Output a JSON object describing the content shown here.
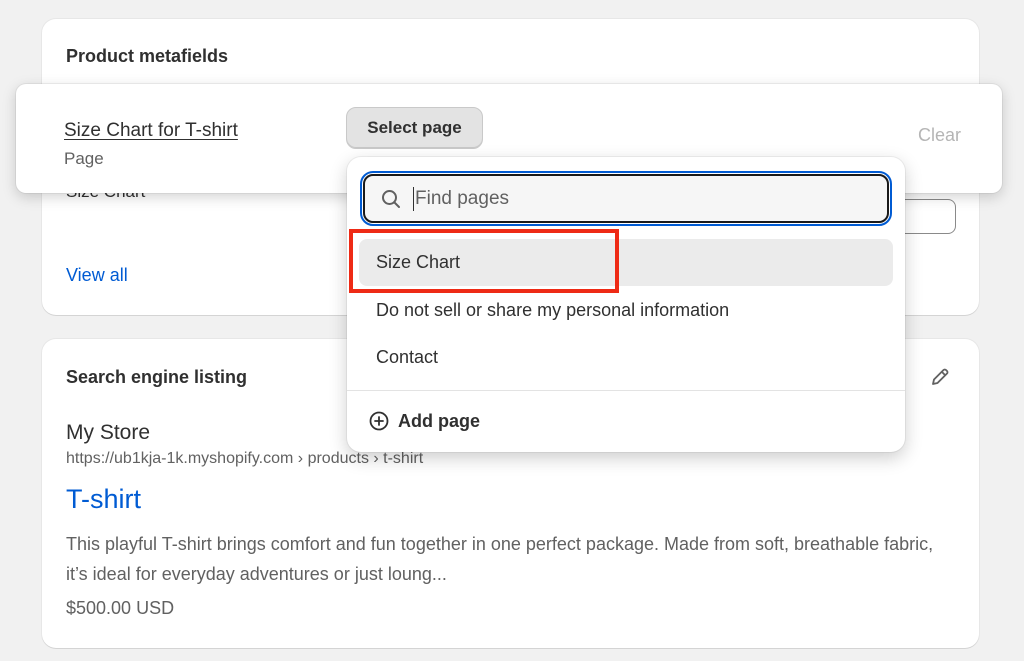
{
  "metafields_card": {
    "title": "Product metafields",
    "ghost_label": "Size Chart",
    "view_all": "View all"
  },
  "metafield_row": {
    "name": "Size Chart for T-shirt",
    "type": "Page",
    "select_button": "Select page",
    "clear_button": "Clear"
  },
  "popover": {
    "search": {
      "placeholder": "Find pages",
      "value": ""
    },
    "items": [
      {
        "label": "Size Chart",
        "selected": true
      },
      {
        "label": "Do not sell or share my personal information",
        "selected": false
      },
      {
        "label": "Contact",
        "selected": false
      }
    ],
    "add_page": "Add page"
  },
  "seo_card": {
    "title": "Search engine listing",
    "store_name": "My Store",
    "url": "https://ub1kja-1k.myshopify.com › products › t-shirt",
    "page_title": "T-shirt",
    "description": "This playful T-shirt brings comfort and fun together in one perfect package. Made from soft, breathable fabric, it’s ideal for everyday adventures or just loung...",
    "price": "$500.00 USD"
  },
  "icons": {
    "search": "search-icon",
    "add": "plus-circle-icon",
    "edit": "pencil-icon"
  },
  "colors": {
    "link": "#005bd3",
    "highlight": "#ee2a15",
    "background": "#f1f1f1"
  }
}
